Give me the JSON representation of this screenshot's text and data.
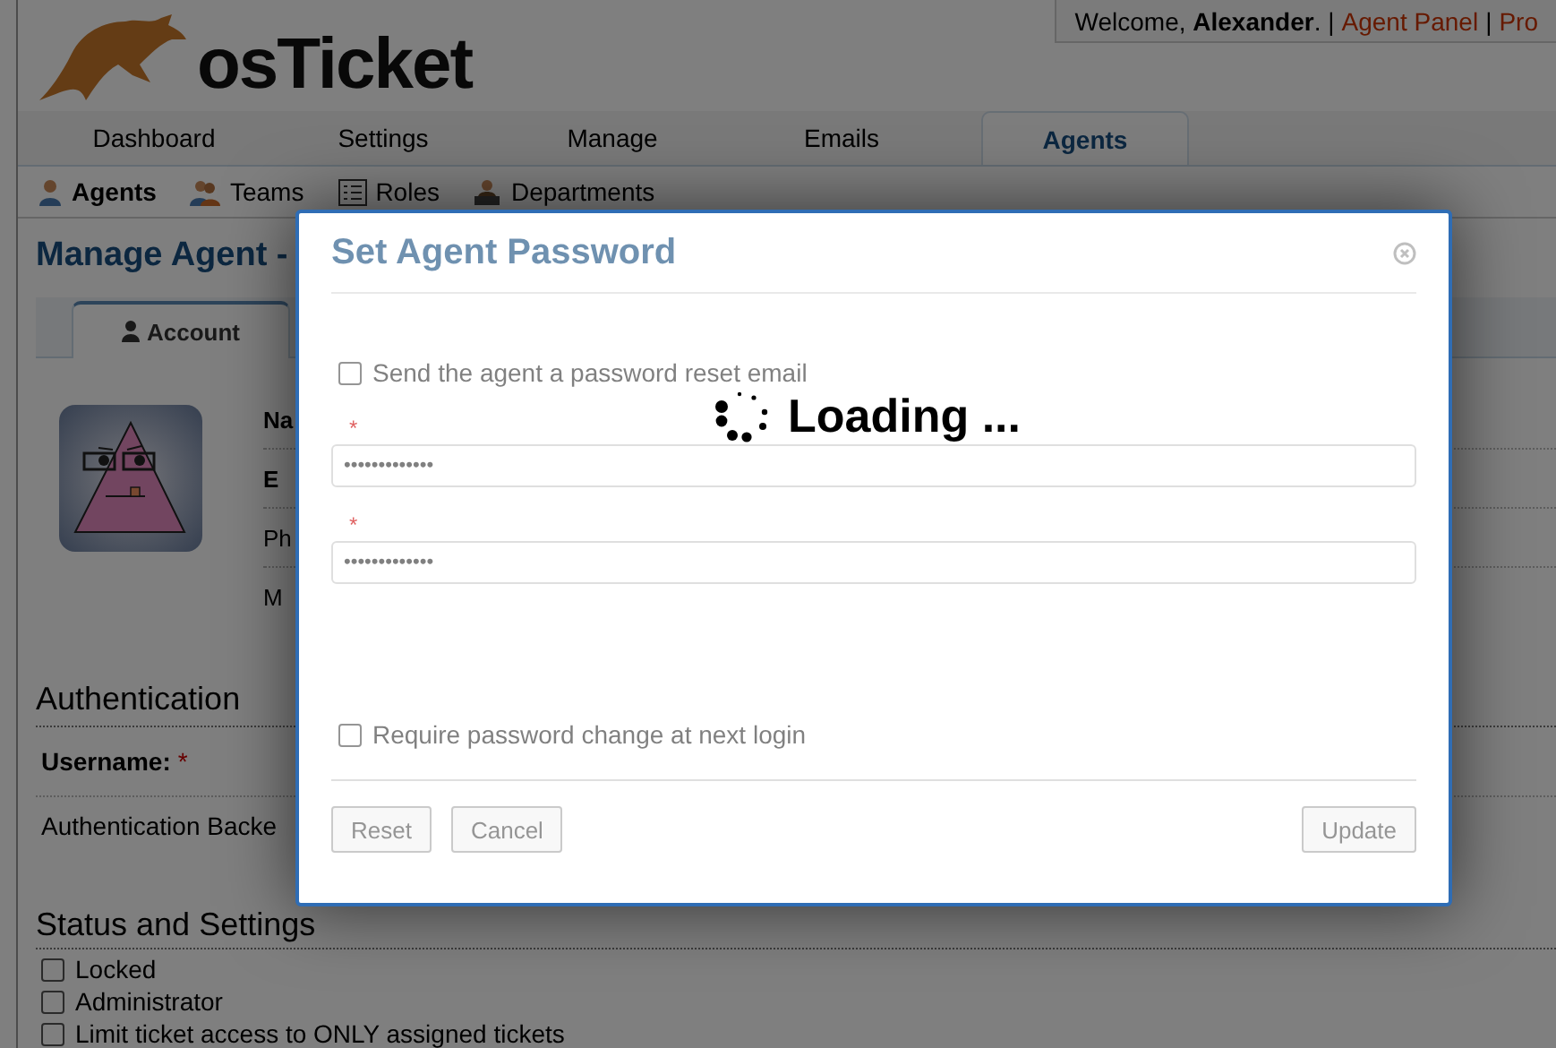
{
  "header": {
    "logo_text": "osTicket",
    "welcome": "Welcome, **Alexander**. |",
    "links": [
      {
        "label": "Agent Panel",
        "separator": "|"
      },
      {
        "label": "Pro"
      }
    ]
  },
  "nav_tabs": [
    {
      "label": "Dashboard",
      "selected": false
    },
    {
      "label": "Settings",
      "selected": false
    },
    {
      "label": "Manage",
      "selected": false
    },
    {
      "label": "Emails",
      "selected": false
    },
    {
      "label": "Agents",
      "selected": true
    }
  ],
  "sub_nav": [
    {
      "label": "Agents",
      "selected": true
    },
    {
      "label": "Teams",
      "selected": false
    },
    {
      "label": "Roles",
      "selected": false
    },
    {
      "label": "Departments",
      "selected": false
    }
  ],
  "page": {
    "title": "Manage Agent -",
    "tabs": [
      {
        "label": "Account",
        "selected": true
      }
    ],
    "profile_fields": [
      {
        "label": "Na",
        "strong": true
      },
      {
        "label": "E",
        "strong": true
      },
      {
        "label": "Ph",
        "strong": false
      },
      {
        "label": "M",
        "strong": false
      }
    ],
    "auth": {
      "heading": "Authentication",
      "username_label": "Username:",
      "required_mark": "*",
      "backend_label": "Authentication Backe"
    },
    "status": {
      "heading": "Status and Settings",
      "options": [
        {
          "label": "Locked",
          "checked": false
        },
        {
          "label": "Administrator",
          "checked": false
        },
        {
          "label": "Limit ticket access to ONLY assigned tickets",
          "checked": false
        }
      ]
    }
  },
  "modal": {
    "title": "Set Agent Password",
    "loading": true,
    "loading_text": "Loading ...",
    "send_email": {
      "label": "Send the agent a password reset email",
      "checked": false
    },
    "fields": [
      {
        "required_mark": "*",
        "value": "•••••••••••••"
      },
      {
        "required_mark": "*",
        "value": "•••••••••••••"
      }
    ],
    "require_change": {
      "label": "Require password change at next login",
      "checked": false
    },
    "buttons": [
      {
        "label": "Reset",
        "disabled": true
      },
      {
        "label": "Cancel",
        "disabled": true
      },
      {
        "label": "Update",
        "disabled": true
      }
    ]
  }
}
